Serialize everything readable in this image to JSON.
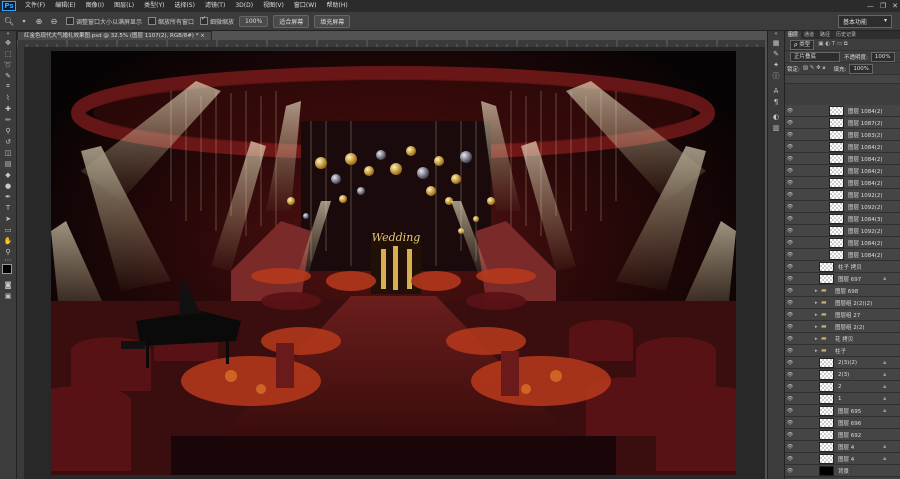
{
  "app": {
    "logo": "Ps"
  },
  "menu": [
    "文件(F)",
    "编辑(E)",
    "图像(I)",
    "图层(L)",
    "类型(Y)",
    "选择(S)",
    "滤镜(T)",
    "3D(D)",
    "视图(V)",
    "窗口(W)",
    "帮助(H)"
  ],
  "window_controls": {
    "minimize": "—",
    "maximize": "❐",
    "close": "✕"
  },
  "options": {
    "resize_windows_label": "调整窗口大小以满屏显示",
    "zoom_all_label": "缩放所有窗口",
    "scrubby_zoom_label": "细微缩放",
    "actual_pixels_btn": "100%",
    "fit_screen_btn": "适合屏幕",
    "fill_screen_btn": "填充屏幕",
    "workspace": "基本功能"
  },
  "document": {
    "tab_title": "红金色现代大气婚礼效果图.psd @ 32.5% (图层 1107(2), RGB/8#) *",
    "close_glyph": "×"
  },
  "panel": {
    "tabs": [
      "图层",
      "通道",
      "路径",
      "历史记录"
    ],
    "filter_label": "ρ 类型",
    "blend_mode": "正片叠底",
    "opacity_label": "不透明度:",
    "opacity_value": "100%",
    "lock_label": "锁定:",
    "fill_label": "填充:",
    "fill_value": "100%"
  },
  "layers": [
    {
      "name": "图层 1084(2)",
      "type": "pixel",
      "indent": 1
    },
    {
      "name": "图层 1087(2)",
      "type": "pixel",
      "indent": 1
    },
    {
      "name": "图层 1083(2)",
      "type": "pixel",
      "indent": 1
    },
    {
      "name": "图层 1084(2)",
      "type": "pixel",
      "indent": 1
    },
    {
      "name": "图层 1084(2)",
      "type": "pixel",
      "indent": 1
    },
    {
      "name": "图层 1084(2)",
      "type": "pixel",
      "indent": 1
    },
    {
      "name": "图层 1084(2)",
      "type": "pixel",
      "indent": 1
    },
    {
      "name": "图层 1092(2)",
      "type": "pixel",
      "indent": 1
    },
    {
      "name": "图层 1092(2)",
      "type": "pixel",
      "indent": 1
    },
    {
      "name": "图层 1084(3)",
      "type": "pixel",
      "indent": 1
    },
    {
      "name": "图层 1092(2)",
      "type": "pixel",
      "indent": 1
    },
    {
      "name": "图层 1084(2)",
      "type": "pixel",
      "indent": 1
    },
    {
      "name": "图层 1084(2)",
      "type": "pixel",
      "indent": 1
    },
    {
      "name": "柱子 拷贝",
      "type": "pixel",
      "indent": 0
    },
    {
      "name": "图层 697",
      "type": "pixel",
      "indent": 0,
      "locked": true
    },
    {
      "name": "图层 698",
      "type": "folder",
      "indent": 0
    },
    {
      "name": "图层组 2(2)(2)",
      "type": "folder",
      "indent": 0
    },
    {
      "name": "图层组 27",
      "type": "folder",
      "indent": 0
    },
    {
      "name": "图层组 2(2)",
      "type": "folder",
      "indent": 0
    },
    {
      "name": "花 拷贝",
      "type": "folder",
      "indent": 0
    },
    {
      "name": "柱子",
      "type": "folder",
      "indent": 0
    },
    {
      "name": "2(3)(2)",
      "type": "pixel",
      "indent": 0,
      "locked": true
    },
    {
      "name": "2(3)",
      "type": "pixel",
      "indent": 0,
      "locked": true
    },
    {
      "name": "2",
      "type": "pixel",
      "indent": 0,
      "locked": true
    },
    {
      "name": "1",
      "type": "pixel",
      "indent": 0,
      "locked": true
    },
    {
      "name": "图层 695",
      "type": "pixel",
      "indent": 0,
      "locked": true
    },
    {
      "name": "图层 696",
      "type": "pixel",
      "indent": 0
    },
    {
      "name": "图层 692",
      "type": "pixel",
      "indent": 0
    },
    {
      "name": "图层 4",
      "type": "pixel",
      "indent": 0,
      "locked": true
    },
    {
      "name": "图层 4",
      "type": "pixel",
      "indent": 0,
      "locked": true
    },
    {
      "name": "背景",
      "type": "black",
      "indent": 0
    }
  ],
  "art_text": "Wedding"
}
